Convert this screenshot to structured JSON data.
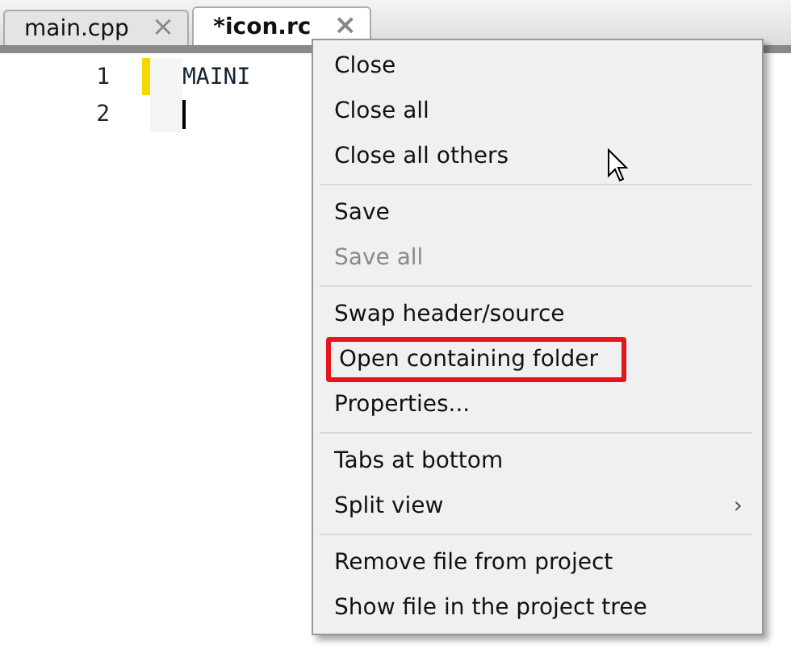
{
  "tabs": [
    {
      "label": "main.cpp",
      "close": "×",
      "selected": false
    },
    {
      "label": "*icon.rc",
      "close": "×",
      "selected": true
    }
  ],
  "editor": {
    "lines": [
      {
        "number": "1",
        "text": "MAINI",
        "modified": true
      },
      {
        "number": "2",
        "modified": false,
        "caret": true
      }
    ]
  },
  "context_menu": {
    "groups": [
      [
        {
          "label": "Close",
          "disabled": false
        },
        {
          "label": "Close all",
          "disabled": false
        },
        {
          "label": "Close all others",
          "disabled": false
        }
      ],
      [
        {
          "label": "Save",
          "disabled": false
        },
        {
          "label": "Save all",
          "disabled": true
        }
      ],
      [
        {
          "label": "Swap header/source",
          "disabled": false
        },
        {
          "label": "Open containing folder",
          "disabled": false,
          "highlighted": true
        },
        {
          "label": "Properties...",
          "disabled": false
        }
      ],
      [
        {
          "label": "Tabs at bottom",
          "disabled": false
        },
        {
          "label": "Split view",
          "disabled": false,
          "submenu": "›"
        }
      ],
      [
        {
          "label": "Remove file from project",
          "disabled": false
        },
        {
          "label": "Show file in the project tree",
          "disabled": false
        }
      ]
    ]
  }
}
